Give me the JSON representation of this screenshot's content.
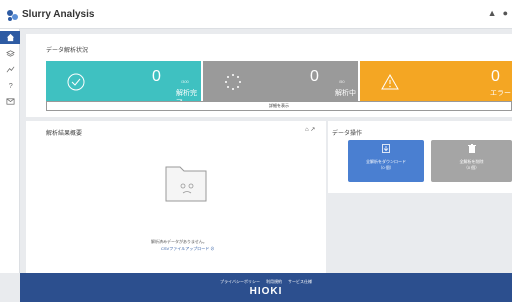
{
  "app": {
    "title": "Slurry Analysis"
  },
  "sidebar": {
    "items": [
      {
        "icon": "home-icon"
      },
      {
        "icon": "layers-icon"
      },
      {
        "icon": "chart-icon"
      },
      {
        "icon": "help-icon"
      },
      {
        "icon": "mail-icon"
      }
    ]
  },
  "status": {
    "title": "データ解析状況",
    "cards": [
      {
        "count": "0",
        "unit": "/300",
        "label": "解析完了",
        "color": "#3fc1c1",
        "icon": "check-circle-icon"
      },
      {
        "count": "0",
        "unit": "/50",
        "label": "解析中",
        "color": "#9a9a9a",
        "icon": "spinner-icon"
      },
      {
        "count": "0",
        "unit": "",
        "label": "エラー",
        "color": "#f4a623",
        "icon": "warning-icon"
      }
    ],
    "detail_label": "詳細を表示"
  },
  "results": {
    "title": "解析結果概要",
    "empty_text": "解析済みデータがありません。",
    "upload_link": "CSVファイルアップロード ⊘"
  },
  "data_ops": {
    "title": "データ操作",
    "download": {
      "line1": "全解析をダウンロード",
      "line2": "（0 個）",
      "color": "#4a7fd1"
    },
    "delete": {
      "line1": "全解析を削除",
      "line2": "（0 個）",
      "color": "#a5a5a5"
    }
  },
  "footer": {
    "links": [
      "プライバシーポリシー",
      "利用規約",
      "サービス仕様"
    ],
    "logo": "HIOKI",
    "color": "#2c4f8e"
  }
}
